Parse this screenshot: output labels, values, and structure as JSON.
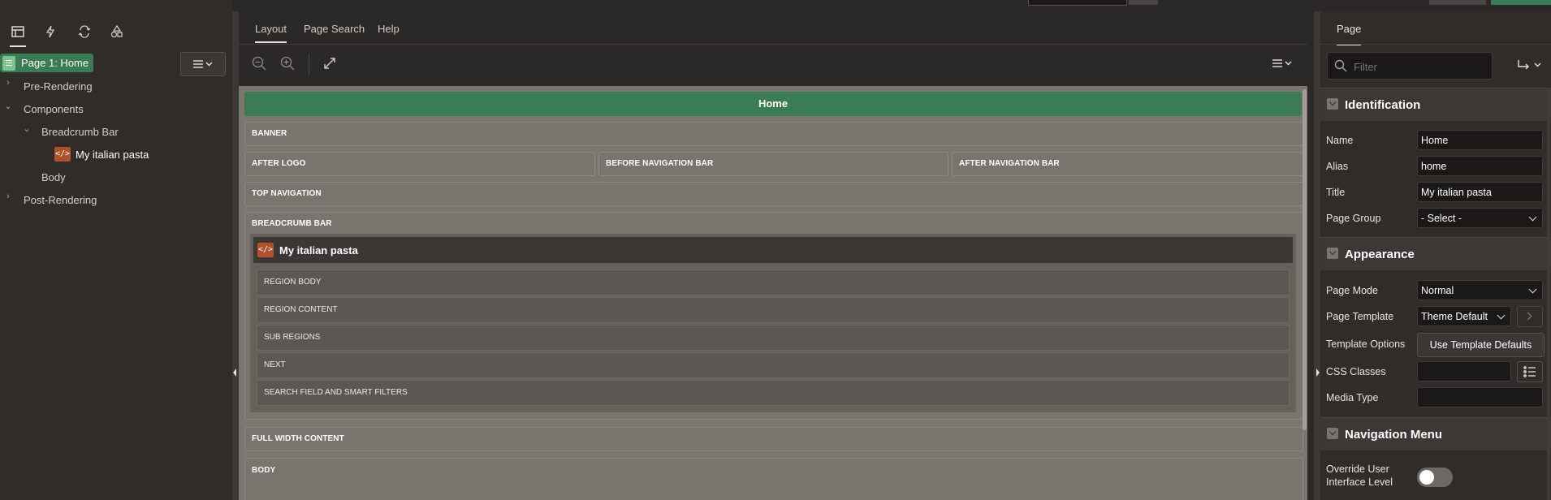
{
  "left_panel": {
    "tabs": [
      "rendering-tree-icon",
      "dynamic-actions-icon",
      "processing-icon",
      "shared-components-icon"
    ],
    "page_badge": "Page 1: Home",
    "tree": {
      "pre_rendering": "Pre-Rendering",
      "components": "Components",
      "breadcrumb_bar": "Breadcrumb Bar",
      "region": "My italian pasta",
      "body": "Body",
      "post_rendering": "Post-Rendering"
    }
  },
  "center": {
    "tabs": {
      "layout": "Layout",
      "page_search": "Page Search",
      "help": "Help"
    },
    "canvas": {
      "page_title": "Home",
      "banner": "BANNER",
      "after_logo": "AFTER LOGO",
      "before_nav": "BEFORE NAVIGATION BAR",
      "after_nav": "AFTER NAVIGATION BAR",
      "top_nav": "TOP NAVIGATION",
      "breadcrumb_bar": "BREADCRUMB BAR",
      "region_title": "My italian pasta",
      "region_body": "REGION BODY",
      "region_content": "REGION CONTENT",
      "sub_regions": "SUB REGIONS",
      "next": "NEXT",
      "search_field": "SEARCH FIELD AND SMART FILTERS",
      "full_width": "FULL WIDTH CONTENT",
      "body": "BODY"
    }
  },
  "right_panel": {
    "tab": "Page",
    "filter_placeholder": "Filter",
    "identification": {
      "title": "Identification",
      "name_label": "Name",
      "name_value": "Home",
      "alias_label": "Alias",
      "alias_value": "home",
      "title_label": "Title",
      "title_value": "My italian pasta",
      "group_label": "Page Group",
      "group_value": "- Select -"
    },
    "appearance": {
      "title": "Appearance",
      "mode_label": "Page Mode",
      "mode_value": "Normal",
      "template_label": "Page Template",
      "template_value": "Theme Default",
      "options_label": "Template Options",
      "options_button": "Use Template Defaults",
      "css_label": "CSS Classes",
      "media_label": "Media Type"
    },
    "navigation": {
      "title": "Navigation Menu",
      "override_label_1": "Override User",
      "override_label_2": "Interface Level"
    }
  },
  "colors": {
    "accent_green": "#3a7d55",
    "code_icon": "#b0512b"
  }
}
